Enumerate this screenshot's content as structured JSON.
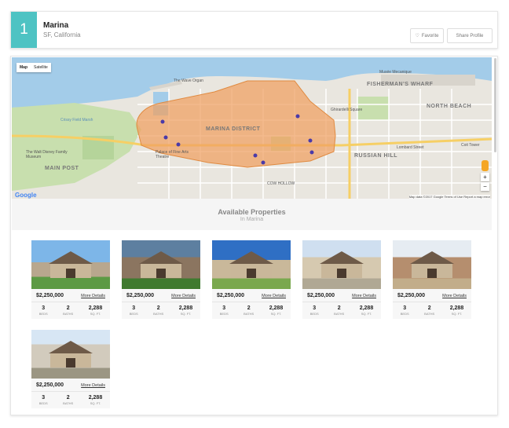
{
  "header": {
    "badge": "1",
    "title": "Marina",
    "subtitle": "SF, California",
    "favorite_label": "Favorite",
    "share_label": "Share Profile"
  },
  "map": {
    "toggle_map": "Map",
    "toggle_satellite": "Satellite",
    "footer": "Map data ©2017 Google   Terms of Use   Report a map error",
    "google": "Google",
    "zoom_in": "+",
    "zoom_out": "−",
    "labels": {
      "marina_district": "MARINA DISTRICT",
      "fishermans_wharf": "FISHERMAN'S WHARF",
      "north_beach": "NORTH BEACH",
      "russian_hill": "RUSSIAN HILL",
      "main_post": "MAIN POST",
      "cow_hollow": "COW HOLLOW",
      "palace": "Palace of Fine Arts Theatre",
      "walt_disney": "The Walt Disney Family Museum",
      "wave_organ": "The Wave Organ",
      "crissy": "Crissy Field Marsh",
      "ghirardelli": "Ghirardelli Square",
      "lombard": "Lombard Street",
      "coit": "Coit Tower",
      "musee": "Musée Mecanique"
    },
    "pin_color": "#4a3aa8",
    "area_color": "#f0a060"
  },
  "section": {
    "title": "Available Properties",
    "subtitle": "In Marina"
  },
  "properties": [
    {
      "price": "$2,250,000",
      "details": "More Details",
      "beds": "3",
      "beds_label": "BEDS",
      "baths": "2",
      "baths_label": "BATHS",
      "sqft": "2,288",
      "sqft_label": "SQ. FT."
    },
    {
      "price": "$2,250,000",
      "details": "More Details",
      "beds": "3",
      "beds_label": "BEDS",
      "baths": "2",
      "baths_label": "BATHS",
      "sqft": "2,288",
      "sqft_label": "SQ. FT."
    },
    {
      "price": "$2,250,000",
      "details": "More Details",
      "beds": "3",
      "beds_label": "BEDS",
      "baths": "2",
      "baths_label": "BATHS",
      "sqft": "2,288",
      "sqft_label": "SQ. FT."
    },
    {
      "price": "$2,250,000",
      "details": "More Details",
      "beds": "3",
      "beds_label": "BEDS",
      "baths": "2",
      "baths_label": "BATHS",
      "sqft": "2,288",
      "sqft_label": "SQ. FT."
    },
    {
      "price": "$2,250,000",
      "details": "More Details",
      "beds": "3",
      "beds_label": "BEDS",
      "baths": "2",
      "baths_label": "BATHS",
      "sqft": "2,288",
      "sqft_label": "SQ. FT."
    },
    {
      "price": "$2,250,000",
      "details": "More Details",
      "beds": "3",
      "beds_label": "BEDS",
      "baths": "2",
      "baths_label": "BATHS",
      "sqft": "2,288",
      "sqft_label": "SQ. FT."
    }
  ]
}
